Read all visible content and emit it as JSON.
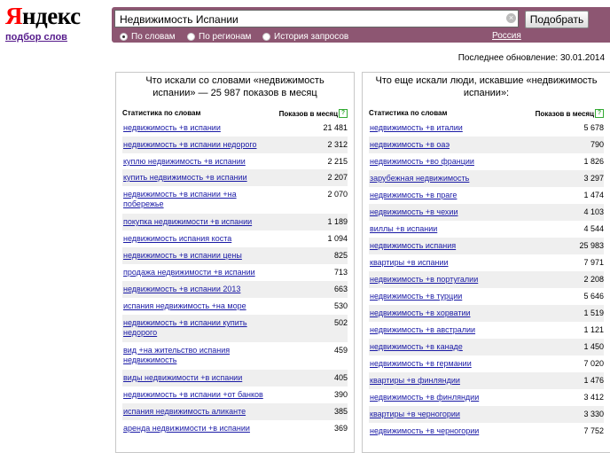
{
  "logo": {
    "first": "Я",
    "rest": "ндекс"
  },
  "sub_link": "подбор слов",
  "search": {
    "value": "Недвижимость Испании",
    "button": "Подобрать"
  },
  "radios": [
    {
      "label": "По словам",
      "selected": true
    },
    {
      "label": "По регионам",
      "selected": false
    },
    {
      "label": "История запросов",
      "selected": false
    }
  ],
  "region": "Россия",
  "last_update": "Последнее обновление: 30.01.2014",
  "left": {
    "title": "Что искали со словами «недвижимость испании» — 25 987 показов в месяц",
    "col1": "Статистика по словам",
    "col2": "Показов в месяц",
    "rows": [
      {
        "phrase": "недвижимость +в испании",
        "count": "21 481"
      },
      {
        "phrase": "недвижимость +в испании недорого",
        "count": "2 312"
      },
      {
        "phrase": "куплю недвижимость +в испании",
        "count": "2 215"
      },
      {
        "phrase": "купить недвижимость +в испании",
        "count": "2 207"
      },
      {
        "phrase": "недвижимость +в испании +на побережье",
        "count": "2 070"
      },
      {
        "phrase": "покупка недвижимости +в испании",
        "count": "1 189"
      },
      {
        "phrase": "недвижимость испания коста",
        "count": "1 094"
      },
      {
        "phrase": "недвижимость +в испании цены",
        "count": "825"
      },
      {
        "phrase": "продажа недвижимости +в испании",
        "count": "713"
      },
      {
        "phrase": "недвижимость +в испании 2013",
        "count": "663"
      },
      {
        "phrase": "испания недвижимость +на море",
        "count": "530"
      },
      {
        "phrase": "недвижимость +в испании купить недорого",
        "count": "502"
      },
      {
        "phrase": "вид +на жительство испания недвижимость",
        "count": "459"
      },
      {
        "phrase": "виды недвижимости +в испании",
        "count": "405"
      },
      {
        "phrase": "недвижимость +в испании +от банков",
        "count": "390"
      },
      {
        "phrase": "испания недвижимость аликанте",
        "count": "385"
      },
      {
        "phrase": "аренда недвижимости +в испании",
        "count": "369"
      }
    ]
  },
  "right": {
    "title": "Что еще искали люди, искавшие «недвижимость испании»:",
    "col1": "Статистика по словам",
    "col2": "Показов в месяц",
    "rows": [
      {
        "phrase": "недвижимость +в италии",
        "count": "5 678"
      },
      {
        "phrase": "недвижимость +в оаэ",
        "count": "790"
      },
      {
        "phrase": "недвижимость +во франции",
        "count": "1 826"
      },
      {
        "phrase": "зарубежная недвижимость",
        "count": "3 297"
      },
      {
        "phrase": "недвижимость +в праге",
        "count": "1 474"
      },
      {
        "phrase": "недвижимость +в чехии",
        "count": "4 103"
      },
      {
        "phrase": "виллы +в испании",
        "count": "4 544"
      },
      {
        "phrase": "недвижимость испания",
        "count": "25 983"
      },
      {
        "phrase": "квартиры +в испании",
        "count": "7 971"
      },
      {
        "phrase": "недвижимость +в португалии",
        "count": "2 208"
      },
      {
        "phrase": "недвижимость +в турции",
        "count": "5 646"
      },
      {
        "phrase": "недвижимость +в хорватии",
        "count": "1 519"
      },
      {
        "phrase": "недвижимость +в австралии",
        "count": "1 121"
      },
      {
        "phrase": "недвижимость +в канаде",
        "count": "1 450"
      },
      {
        "phrase": "недвижимость +в германии",
        "count": "7 020"
      },
      {
        "phrase": "квартиры +в финляндии",
        "count": "1 476"
      },
      {
        "phrase": "недвижимость +в финляндии",
        "count": "3 412"
      },
      {
        "phrase": "квартиры +в черногории",
        "count": "3 330"
      },
      {
        "phrase": "недвижимость +в черногории",
        "count": "7 752"
      }
    ]
  }
}
